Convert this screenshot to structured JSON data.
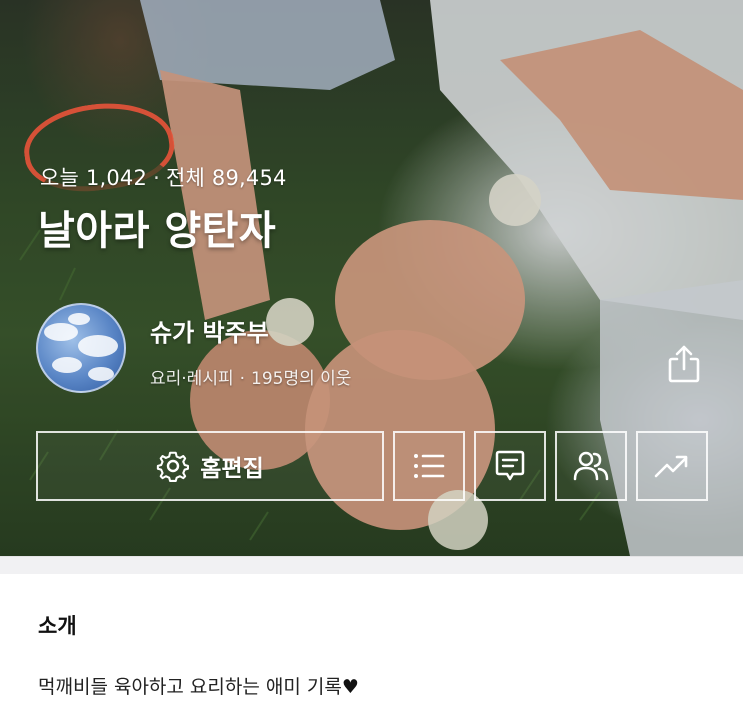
{
  "stats": {
    "today_label": "오늘",
    "today_count": "1,042",
    "separator": "·",
    "total_label": "전체",
    "total_count": "89,454"
  },
  "blog": {
    "title": "날아라 양탄자"
  },
  "profile": {
    "nickname": "슈가 박주부",
    "category": "요리·레시피",
    "separator": "·",
    "neighbors": "195명의 이웃"
  },
  "actions": {
    "edit_label": "홈편집",
    "icons": [
      "gear-icon",
      "list-icon",
      "comment-icon",
      "people-icon",
      "trend-icon",
      "share-icon"
    ]
  },
  "intro": {
    "title": "소개",
    "text": "먹깨비들 육아하고 요리하는 애미 기록",
    "heart": "♥"
  },
  "colors": {
    "annotation": "#e8543a",
    "divider": "#f1f1f3"
  }
}
